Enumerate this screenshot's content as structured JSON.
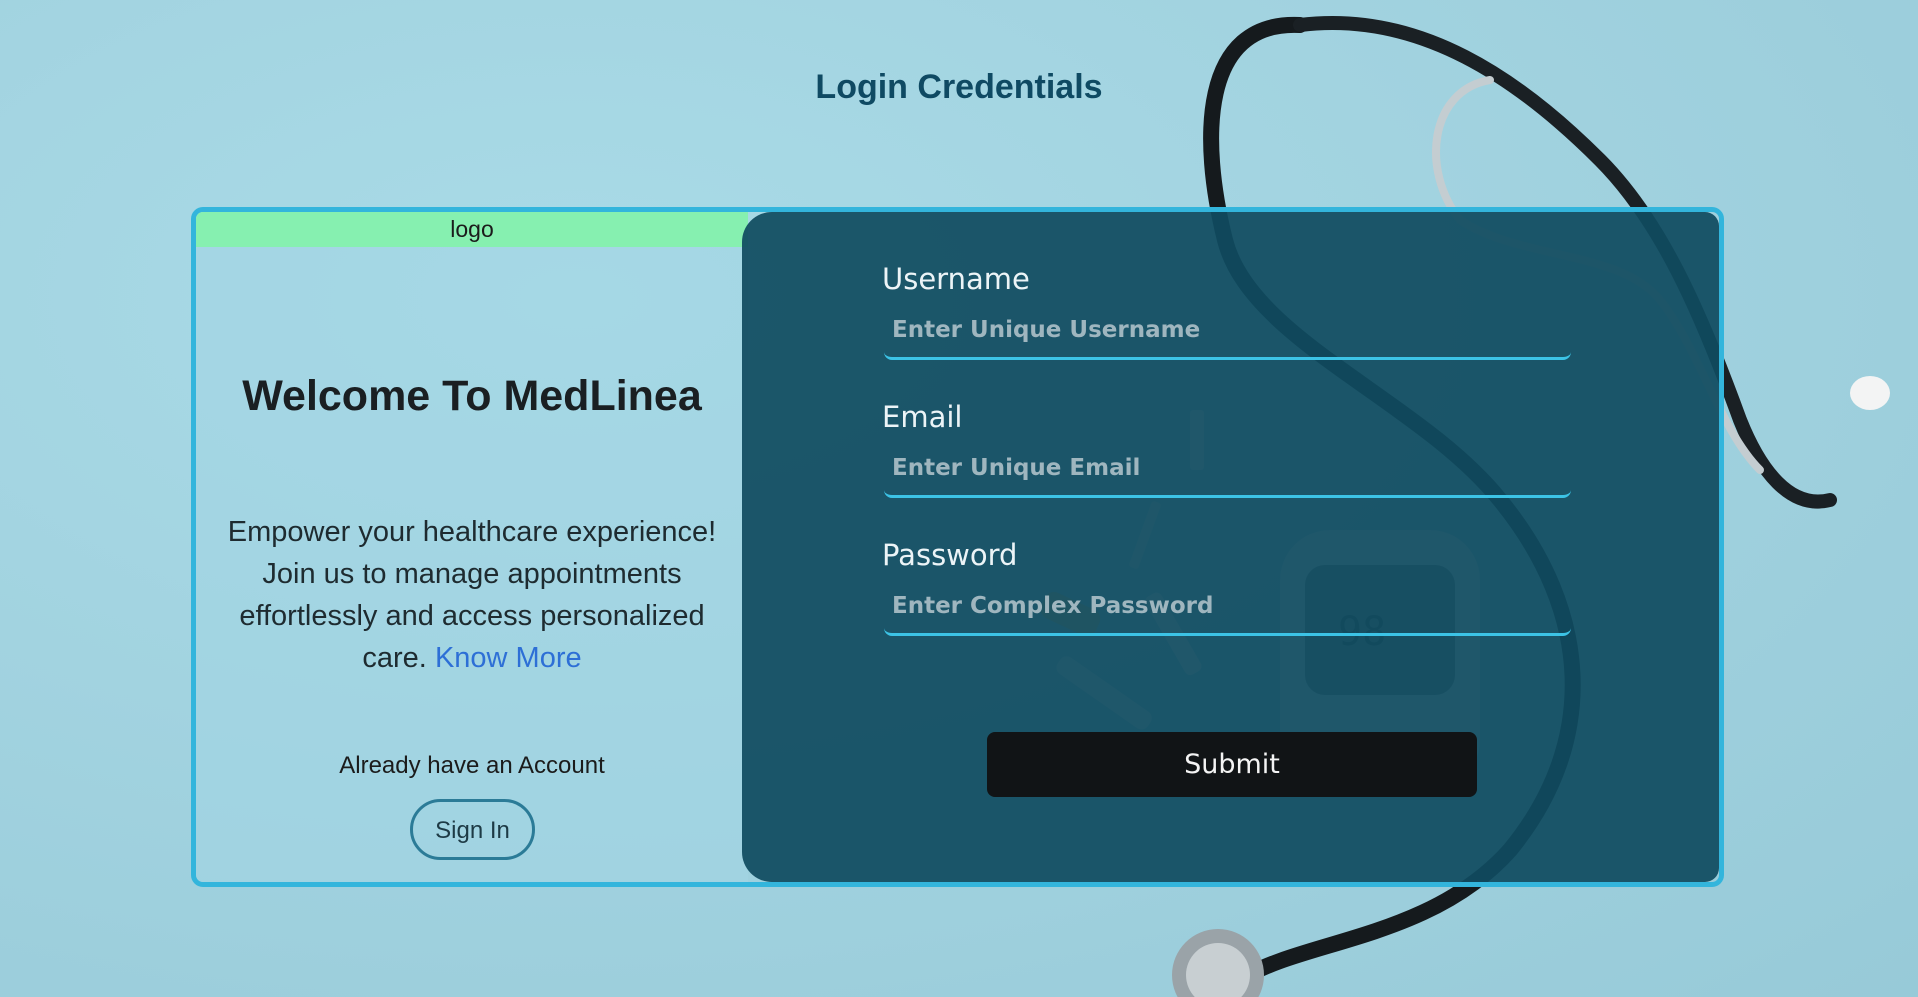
{
  "page": {
    "title": "Login Credentials"
  },
  "left_panel": {
    "logo": "logo",
    "welcome": "Welcome To MedLinea",
    "description": "Empower your healthcare experience! Join us to manage appointments effortlessly and access personalized care.",
    "know_more_link": "Know More",
    "account_prompt": "Already have an Account",
    "sign_in_label": "Sign In"
  },
  "form": {
    "username": {
      "label": "Username",
      "placeholder": "Enter Unique Username",
      "value": ""
    },
    "email": {
      "label": "Email",
      "placeholder": "Enter Unique Email",
      "value": ""
    },
    "password": {
      "label": "Password",
      "placeholder": "Enter Complex Password",
      "value": ""
    },
    "submit_label": "Submit"
  },
  "background": {
    "icon": "stethoscope-icon",
    "glucometer_reading": "98"
  },
  "colors": {
    "page_bg": "#a3d6e3",
    "title": "#0f4a63",
    "card_border": "#33b5dc",
    "logo_bar": "#86f0b0",
    "form_panel": "#104b60",
    "input_underline": "#3cc3e6",
    "link": "#2d6fd6",
    "submit_bg": "#111416"
  }
}
